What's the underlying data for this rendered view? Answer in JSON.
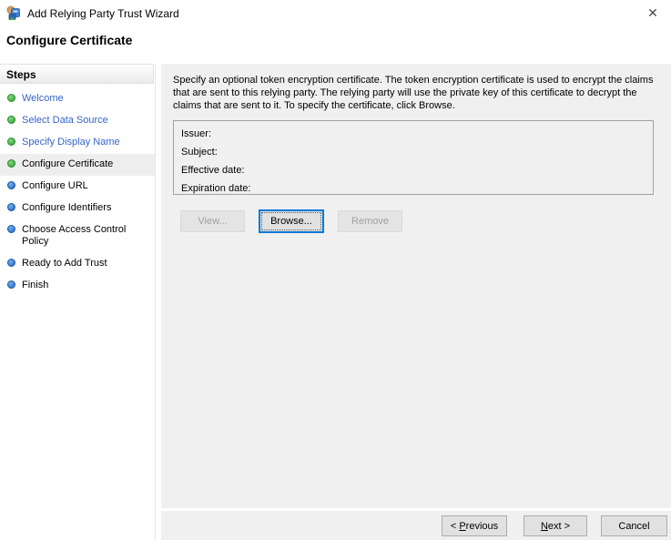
{
  "window": {
    "title": "Add Relying Party Trust Wizard",
    "close_glyph": "✕"
  },
  "page": {
    "heading": "Configure Certificate"
  },
  "sidebar": {
    "header": "Steps",
    "steps": [
      {
        "label": "Welcome",
        "status": "completed"
      },
      {
        "label": "Select Data Source",
        "status": "completed"
      },
      {
        "label": "Specify Display Name",
        "status": "completed"
      },
      {
        "label": "Configure Certificate",
        "status": "current"
      },
      {
        "label": "Configure URL",
        "status": "upcoming"
      },
      {
        "label": "Configure Identifiers",
        "status": "upcoming"
      },
      {
        "label": "Choose Access Control Policy",
        "status": "upcoming"
      },
      {
        "label": "Ready to Add Trust",
        "status": "upcoming"
      },
      {
        "label": "Finish",
        "status": "upcoming"
      }
    ]
  },
  "main": {
    "description": "Specify an optional token encryption certificate.  The token encryption certificate is used to encrypt the claims that are sent to this relying party.  The relying party will use the private key of this certificate to decrypt the claims that are sent to it.  To specify the certificate, click Browse.",
    "certificate_box": {
      "fields": [
        {
          "label": "Issuer:",
          "value": ""
        },
        {
          "label": "Subject:",
          "value": ""
        },
        {
          "label": "Effective date:",
          "value": ""
        },
        {
          "label": "Expiration date:",
          "value": ""
        }
      ]
    },
    "buttons": {
      "view": "View...",
      "browse": "Browse...",
      "remove": "Remove"
    }
  },
  "footer": {
    "previous": {
      "prefix": "< ",
      "accesskey": "P",
      "suffix": "revious"
    },
    "next": {
      "prefix": "",
      "accesskey": "N",
      "suffix": "ext >"
    },
    "cancel": "Cancel"
  },
  "colors": {
    "focus_accent": "#0078d7",
    "link_blue": "#3465c8",
    "bullet_green": "#3fae49",
    "bullet_blue": "#2e7bd6",
    "panel_gray": "#f0f0f0"
  }
}
